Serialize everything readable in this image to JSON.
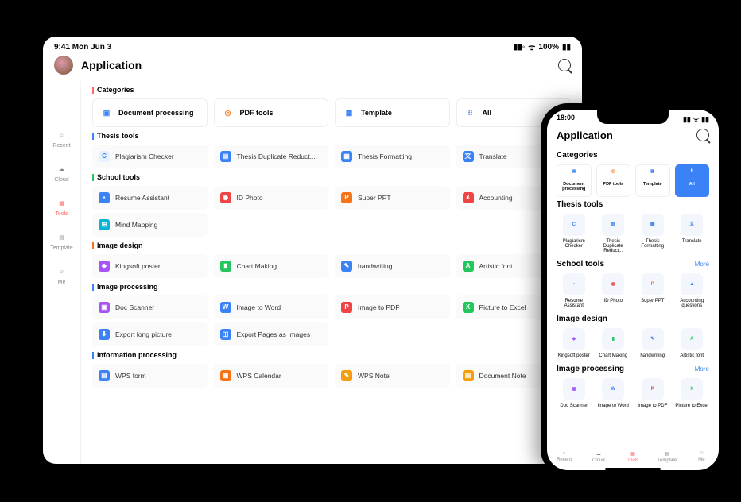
{
  "tablet": {
    "status": {
      "time": "9:41 Mon Jun 3",
      "signal": "▪▪",
      "wifi": "100%"
    },
    "title": "Application",
    "sidebar": [
      {
        "label": "Recent"
      },
      {
        "label": "Cloud"
      },
      {
        "label": "Tools"
      },
      {
        "label": "Template"
      },
      {
        "label": "Me"
      }
    ],
    "categories_label": "Categories",
    "categories": [
      {
        "label": "Document processing"
      },
      {
        "label": "PDF tools"
      },
      {
        "label": "Template"
      },
      {
        "label": "All"
      }
    ],
    "sections": [
      {
        "label": "Thesis tools",
        "rows": [
          [
            {
              "label": "Plagiarism Checker"
            },
            {
              "label": "Thesis Duplicate Reduct..."
            },
            {
              "label": "Thesis Formatting"
            },
            {
              "label": "Translate"
            }
          ]
        ]
      },
      {
        "label": "School tools",
        "rows": [
          [
            {
              "label": "Resume Assistant"
            },
            {
              "label": "ID Photo"
            },
            {
              "label": "Super PPT"
            },
            {
              "label": "Accounting"
            }
          ],
          [
            {
              "label": "Mind Mapping"
            }
          ]
        ]
      },
      {
        "label": "Image design",
        "rows": [
          [
            {
              "label": "Kingsoft  poster"
            },
            {
              "label": "Chart Making"
            },
            {
              "label": "handwriting"
            },
            {
              "label": "Artistic font"
            }
          ]
        ]
      },
      {
        "label": "Image processing",
        "rows": [
          [
            {
              "label": "Doc Scanner"
            },
            {
              "label": "Image to Word"
            },
            {
              "label": "Image to PDF"
            },
            {
              "label": "Picture to Excel"
            }
          ],
          [
            {
              "label": "Export long picture"
            },
            {
              "label": "Export Pages as Images"
            }
          ]
        ]
      },
      {
        "label": "Information processing",
        "rows": [
          [
            {
              "label": "WPS form"
            },
            {
              "label": "WPS Calendar"
            },
            {
              "label": "WPS Note"
            },
            {
              "label": "Document Note"
            }
          ]
        ]
      }
    ]
  },
  "phone": {
    "status": {
      "time": "18:00"
    },
    "title": "Application",
    "categories_label": "Categories",
    "categories": [
      {
        "label": "Document processing"
      },
      {
        "label": "PDF tools"
      },
      {
        "label": "Template"
      },
      {
        "label": "All"
      }
    ],
    "more_label": "More",
    "sections": [
      {
        "label": "Thesis tools",
        "items": [
          {
            "label": "Plagiarism Checker"
          },
          {
            "label": "Thesis Duplicate Reduct..."
          },
          {
            "label": "Thesis Formatting"
          },
          {
            "label": "Translate"
          }
        ]
      },
      {
        "label": "School tools",
        "more": true,
        "items": [
          {
            "label": "Resume Assistant"
          },
          {
            "label": "ID Photo"
          },
          {
            "label": "Super PPT"
          },
          {
            "label": "Accounting questions"
          }
        ]
      },
      {
        "label": "Image design",
        "items": [
          {
            "label": "Kingsoft  poster"
          },
          {
            "label": "Chart Making"
          },
          {
            "label": "handwriting"
          },
          {
            "label": "Artistic font"
          }
        ]
      },
      {
        "label": "Image processing",
        "more": true,
        "items": [
          {
            "label": "Doc Scanner"
          },
          {
            "label": "Image to Word"
          },
          {
            "label": "Image to PDF"
          },
          {
            "label": "Picture to Excel"
          }
        ]
      }
    ],
    "tabs": [
      {
        "label": "Recent"
      },
      {
        "label": "Cloud"
      },
      {
        "label": "Tools"
      },
      {
        "label": "Template"
      },
      {
        "label": "Me"
      }
    ]
  }
}
